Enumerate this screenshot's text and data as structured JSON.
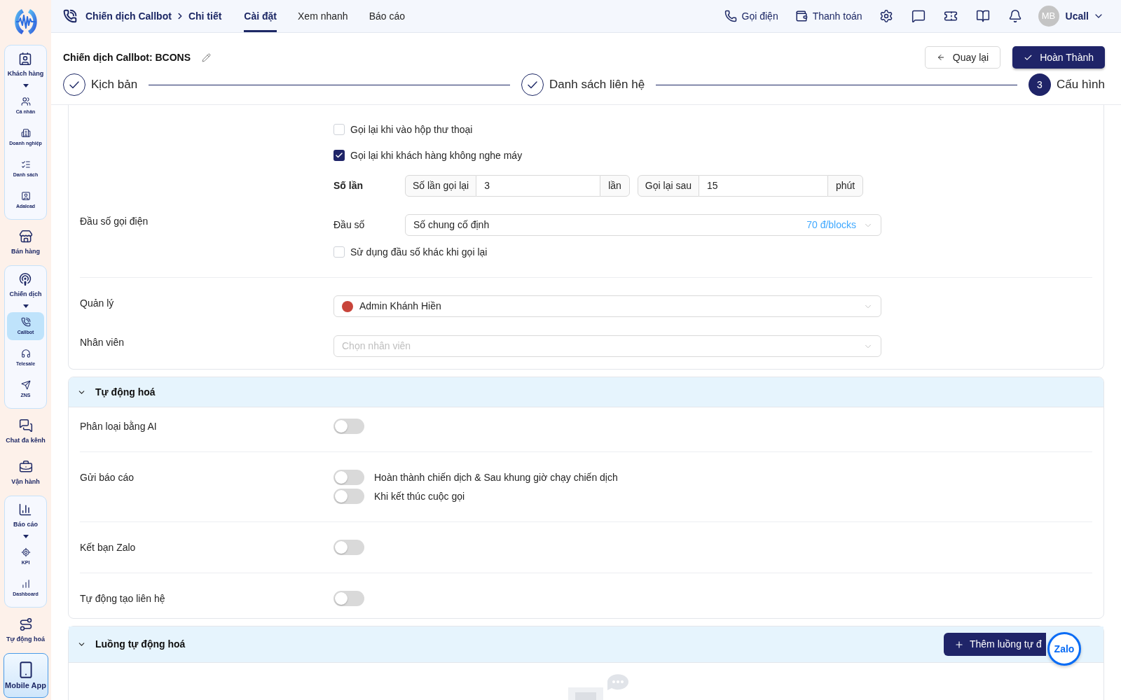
{
  "sidebar": {
    "items": [
      {
        "kind": "group",
        "label": "Khách hàng",
        "selected": false,
        "expanded": true,
        "children": [
          {
            "label": "Cá nhân",
            "selected": false
          },
          {
            "label": "Doanh nghiệp",
            "selected": false
          },
          {
            "label": "Danh sách",
            "selected": false
          },
          {
            "label": "Adalead",
            "selected": false
          }
        ]
      },
      {
        "kind": "link",
        "label": "Bán hàng",
        "selected": false
      },
      {
        "kind": "group",
        "label": "Chiến dịch",
        "selected": false,
        "expanded": true,
        "children": [
          {
            "label": "Callbot",
            "selected": true
          },
          {
            "label": "Telesale",
            "selected": false
          },
          {
            "label": "ZNS",
            "selected": false
          }
        ]
      },
      {
        "kind": "link",
        "label": "Chat đa kênh",
        "selected": false
      },
      {
        "kind": "link",
        "label": "Vận hành",
        "selected": false
      },
      {
        "kind": "group",
        "label": "Báo cáo",
        "selected": false,
        "expanded": true,
        "children": [
          {
            "label": "KPI",
            "selected": false
          },
          {
            "label": "Dashboard",
            "selected": false
          }
        ]
      },
      {
        "kind": "link",
        "label": "Tự động hoá",
        "selected": false
      },
      {
        "kind": "app",
        "label": "Mobile App",
        "selected": false
      }
    ]
  },
  "top_bar": {
    "breadcrumb": [
      "Chiến dịch Callbot",
      "Chi tiết"
    ],
    "tabs": [
      {
        "label": "Cài đặt",
        "selected": true
      },
      {
        "label": "Xem nhanh",
        "selected": false
      },
      {
        "label": "Báo cáo",
        "selected": false
      }
    ],
    "actions": [
      {
        "label": "Gọi điện"
      },
      {
        "label": "Thanh toán"
      }
    ],
    "user": {
      "initials": "MB",
      "name": "Ucall"
    }
  },
  "page_header": {
    "title": "Chiến dịch Callbot: BCONS",
    "buttons": [
      {
        "label": "Quay lại",
        "kind": "secondary"
      },
      {
        "label": "Hoàn Thành",
        "kind": "primary"
      }
    ]
  },
  "stepper": {
    "steps": [
      {
        "label": "Kịch bản",
        "completed": true,
        "current": false
      },
      {
        "label": "Danh sách liên hệ",
        "completed": true,
        "current": false
      },
      {
        "label": "Cấu hình",
        "completed": false,
        "current": true,
        "number": "3"
      }
    ]
  },
  "call_settings": {
    "retry_options": [
      {
        "label": "Gọi lại khi vào hộp thư thoại",
        "checked": false
      },
      {
        "label": "Gọi lại khi khách hàng không nghe máy",
        "checked": true
      }
    ],
    "retry_count": {
      "label": "Số lần",
      "fields": [
        {
          "addon": "Số lần gọi lại",
          "value": "3",
          "suffix": "lần"
        },
        {
          "addon": "Gọi lại sau",
          "value": "15",
          "suffix": "phút"
        }
      ]
    },
    "caller_number": {
      "label": "Đầu số gọi điện",
      "field_label": "Đầu số",
      "value": "Số chung cố định",
      "price": "70 đ/blocks",
      "options": [
        {
          "label": "Sử dụng đầu số khác khi gọi lại",
          "checked": false
        }
      ]
    },
    "manager": {
      "label": "Quản lý",
      "value": "Admin Khánh Hiền"
    },
    "staff": {
      "label": "Nhân viên",
      "placeholder": "Chọn nhân viên"
    }
  },
  "automation": {
    "title": "Tự động hoá",
    "expanded": true,
    "rows": [
      {
        "label": "Phân loại bằng AI",
        "toggles": [
          {
            "on": false
          }
        ]
      },
      {
        "label": "Gửi báo cáo",
        "toggles": [
          {
            "label": "Hoàn thành chiến dịch & Sau khung giờ chạy chiến dịch",
            "on": false
          },
          {
            "label": "Khi kết thúc cuộc gọi",
            "on": false
          }
        ]
      },
      {
        "label": "Kết bạn Zalo",
        "toggles": [
          {
            "on": false
          }
        ]
      },
      {
        "label": "Tự động tạo liên hệ",
        "toggles": [
          {
            "on": false
          }
        ]
      }
    ]
  },
  "flows": {
    "title": "Luồng tự động hoá",
    "expanded": true,
    "button": "Thêm luồng tự đ"
  },
  "chat_widget": {
    "label": "Zalo"
  }
}
